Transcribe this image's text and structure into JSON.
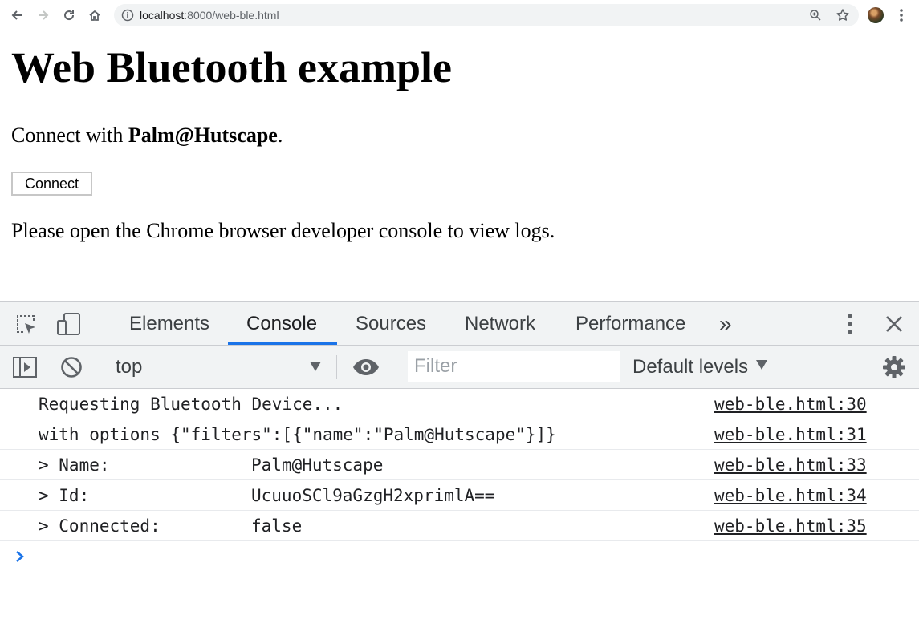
{
  "browser": {
    "url_host": "localhost",
    "url_path": ":8000/web-ble.html"
  },
  "page": {
    "heading": "Web Bluetooth example",
    "connect_prefix": "Connect with ",
    "device_name": "Palm@Hutscape",
    "connect_suffix": ".",
    "button_label": "Connect",
    "info_text": "Please open the Chrome browser developer console to view logs."
  },
  "devtools": {
    "tabs": [
      "Elements",
      "Console",
      "Sources",
      "Network",
      "Performance"
    ],
    "active_tab": "Console",
    "more_tabs": "»",
    "context": "top",
    "filter_placeholder": "Filter",
    "filter_value": "",
    "levels_label": "Default levels"
  },
  "console": {
    "messages": [
      {
        "text": "Requesting Bluetooth Device...",
        "value": "",
        "source": "web-ble.html:30"
      },
      {
        "text": "with options {\"filters\":[{\"name\":\"Palm@Hutscape\"}]}",
        "value": "",
        "source": "web-ble.html:31"
      },
      {
        "text": "> Name:",
        "value": "Palm@Hutscape",
        "source": "web-ble.html:33"
      },
      {
        "text": "> Id:",
        "value": "UcuuoSCl9aGzgH2xprimlA==",
        "source": "web-ble.html:34"
      },
      {
        "text": "> Connected:",
        "value": "false",
        "source": "web-ble.html:35"
      }
    ]
  },
  "colors": {
    "accent": "#1a73e8",
    "toolbar_bg": "#f1f3f4"
  }
}
